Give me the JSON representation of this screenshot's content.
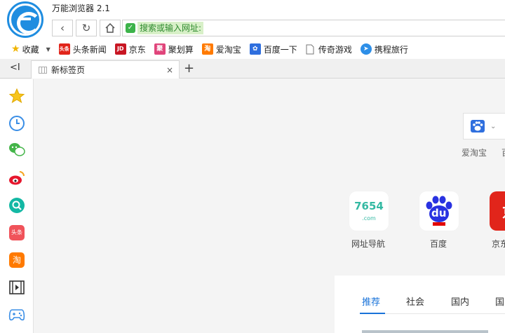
{
  "app": {
    "title": "万能浏览器 2.1"
  },
  "address": {
    "text": "搜索或输入网址:"
  },
  "bookmarks": [
    {
      "label": "收藏",
      "icon": "star-icon"
    },
    {
      "label": "头条新闻",
      "icon": "toutiao-icon",
      "badge": "头条"
    },
    {
      "label": "京东",
      "icon": "jd-icon",
      "badge": "JD"
    },
    {
      "label": "聚划算",
      "icon": "juhuasuan-icon",
      "badge": "聚"
    },
    {
      "label": "爱淘宝",
      "icon": "taobao-icon",
      "badge": "淘"
    },
    {
      "label": "百度一下",
      "icon": "baidu-icon"
    },
    {
      "label": "传奇游戏",
      "icon": "page-icon"
    },
    {
      "label": "携程旅行",
      "icon": "ctrip-icon"
    }
  ],
  "tab": {
    "title": "新标签页",
    "close": "×",
    "new": "+"
  },
  "collapse": "<I",
  "sidebar": [
    "favorites",
    "history",
    "wechat",
    "weibo",
    "search",
    "toutiao",
    "taobao",
    "video",
    "game"
  ],
  "search": {
    "engine_label": "爱淘宝",
    "next_label": "百"
  },
  "sites": [
    {
      "label": "网址导航",
      "logo_text": "7654",
      "logo_sub": ".com"
    },
    {
      "label": "百度",
      "logo_text": "du"
    },
    {
      "label": "京东",
      "logo_text": "京"
    }
  ],
  "news_tabs": [
    "推荐",
    "社会",
    "国内",
    "国"
  ],
  "colors": {
    "accent": "#1f8de0",
    "secure": "#3cb34a",
    "jd_red": "#e1251b",
    "baidu_blue": "#2932e1"
  }
}
